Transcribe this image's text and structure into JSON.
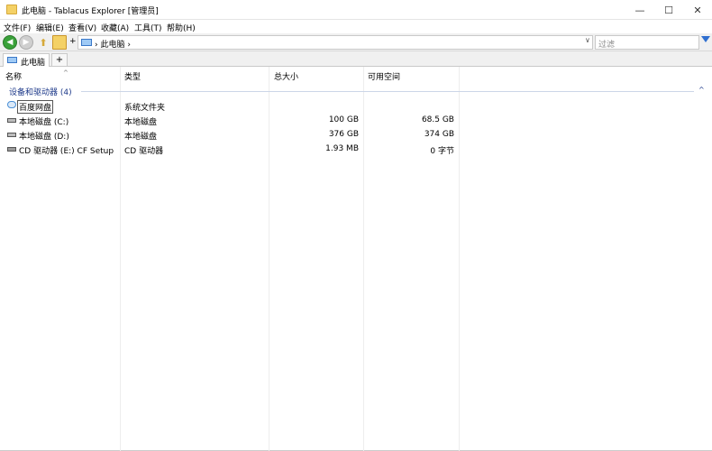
{
  "window": {
    "title": "此电脑 - Tablacus Explorer [管理员]",
    "min_glyph": "—",
    "max_glyph": "☐",
    "close_glyph": "✕"
  },
  "menu": [
    "文件(F)",
    "编辑(E)",
    "查看(V)",
    "收藏(A)",
    "工具(T)",
    "帮助(H)"
  ],
  "toolbar": {
    "back_glyph": "◀",
    "forward_glyph": "▶",
    "up_glyph": "⬆",
    "plus": "+",
    "address_text": "› 此电脑 ›",
    "dropdown_glyph": "∨",
    "filter_placeholder": "过滤"
  },
  "tabs": {
    "items": [
      {
        "label": "此电脑"
      }
    ],
    "add_label": "+"
  },
  "columns": {
    "name": "名称",
    "type": "类型",
    "total": "总大小",
    "free": "可用空间",
    "sort_glyph": "^"
  },
  "group": {
    "label": "设备和驱动器 (4)",
    "collapse_glyph": "^"
  },
  "rows": [
    {
      "name": "百度网盘",
      "type": "系统文件夹",
      "total": "",
      "free": ""
    },
    {
      "name": "本地磁盘 (C:)",
      "type": "本地磁盘",
      "total": "100 GB",
      "free": "68.5 GB"
    },
    {
      "name": "本地磁盘 (D:)",
      "type": "本地磁盘",
      "total": "376 GB",
      "free": "374 GB"
    },
    {
      "name": "CD 驱动器 (E:) CF Setup",
      "type": "CD 驱动器",
      "total": "1.93 MB",
      "free": "0 字节"
    }
  ],
  "colors": {
    "accent": "#2f6fd0",
    "group_text": "#1e3a8a",
    "folder": "#f4d166",
    "nav_back": "#3aa13a"
  }
}
